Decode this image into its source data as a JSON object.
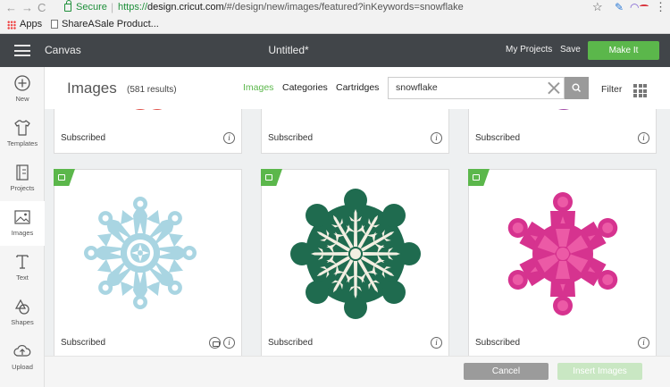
{
  "browser": {
    "secure_label": "Secure",
    "url_scheme": "https://",
    "url_host": "design.cricut.com",
    "url_path": "/#/design/new/images/featured?inKeywords=snowflake",
    "bookmarks": [
      "Apps",
      "ShareASale Product..."
    ]
  },
  "header": {
    "app_label": "Canvas",
    "doc_title": "Untitled*",
    "my_projects_label": "My Projects",
    "save_label": "Save",
    "make_it_label": "Make It",
    "make_it_color": "#5bb74b"
  },
  "rail": {
    "items": [
      {
        "label": "New",
        "icon": "plus-circle-icon"
      },
      {
        "label": "Templates",
        "icon": "shirt-icon"
      },
      {
        "label": "Projects",
        "icon": "projects-icon"
      },
      {
        "label": "Images",
        "icon": "image-icon"
      },
      {
        "label": "Text",
        "icon": "text-icon"
      },
      {
        "label": "Shapes",
        "icon": "shapes-icon"
      },
      {
        "label": "Upload",
        "icon": "upload-cloud-icon"
      }
    ]
  },
  "images_panel": {
    "title": "Images",
    "results": "(581 results)",
    "tabs": [
      "Images",
      "Categories",
      "Cartridges"
    ],
    "active_tab": "Images",
    "search_value": "snowflake",
    "filter_label": "Filter"
  },
  "cards": [
    {
      "label": "Subscribed"
    },
    {
      "label": "Subscribed"
    },
    {
      "label": "Subscribed"
    },
    {
      "label": "Subscribed"
    },
    {
      "label": "Subscribed"
    },
    {
      "label": "Subscribed"
    }
  ],
  "footer": {
    "cancel_label": "Cancel",
    "insert_label": "Insert Images"
  }
}
